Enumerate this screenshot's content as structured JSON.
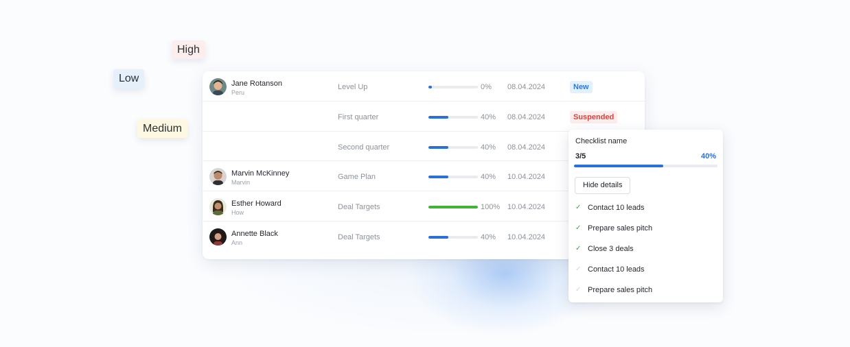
{
  "tags": {
    "high": "High",
    "low": "Low",
    "medium": "Medium"
  },
  "rows": [
    {
      "name": "Jane Rotanson",
      "sub": "Peru",
      "task": "Level Up",
      "progress": 0,
      "pct": "0%",
      "date": "08.04.2024",
      "badge": "New",
      "avatar": "avatar-jane"
    },
    {
      "name": "",
      "sub": "",
      "task": "First quarter",
      "progress": 40,
      "pct": "40%",
      "date": "08.04.2024",
      "badge": "Suspended"
    },
    {
      "name": "",
      "sub": "",
      "task": "Second quarter",
      "progress": 40,
      "pct": "40%",
      "date": "08.04.2024",
      "badge": ""
    },
    {
      "name": "Marvin McKinney",
      "sub": "Marvin",
      "task": "Game Plan",
      "progress": 40,
      "pct": "40%",
      "date": "10.04.2024",
      "badge": "",
      "avatar": "avatar-marvin"
    },
    {
      "name": "Esther Howard",
      "sub": "How",
      "task": "Deal Targets",
      "progress": 100,
      "pct": "100%",
      "date": "10.04.2024",
      "badge": "",
      "avatar": "avatar-esther"
    },
    {
      "name": "Annette Black",
      "sub": "Ann",
      "task": "Deal Targets",
      "progress": 40,
      "pct": "40%",
      "date": "10.04.2024",
      "badge": "",
      "avatar": "avatar-annette"
    }
  ],
  "checklist": {
    "title": "Checklist name",
    "count": "3/5",
    "pct": "40%",
    "progress": 62,
    "hide_label": "Hide details",
    "items": [
      {
        "label": "Contact 10 leads",
        "done": true
      },
      {
        "label": "Prepare sales pitch",
        "done": true
      },
      {
        "label": "Close 3 deals",
        "done": true
      },
      {
        "label": "Contact 10 leads",
        "done": false
      },
      {
        "label": "Prepare sales pitch",
        "done": false
      }
    ]
  },
  "colors": {
    "accent": "#2b6fd9",
    "complete": "#41b336",
    "badge_new": "#2b78d9",
    "badge_suspended": "#d2453d"
  },
  "icons": {
    "check": "check-icon"
  }
}
